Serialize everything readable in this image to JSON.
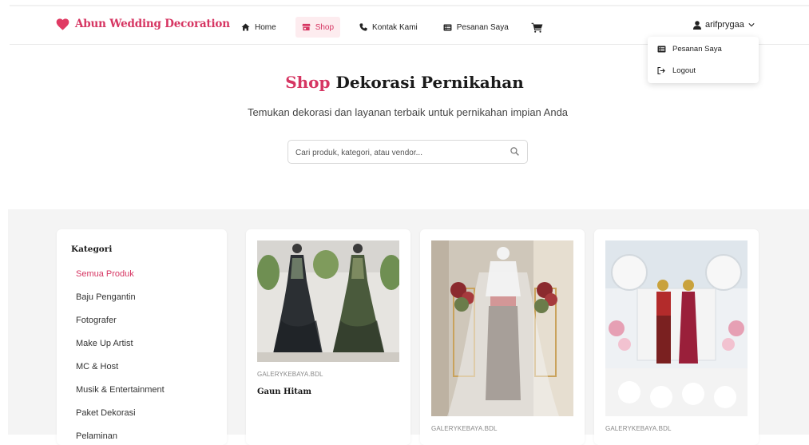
{
  "brand": {
    "name": "Abun Wedding Decoration",
    "color": "#d63562"
  },
  "nav": [
    {
      "label": "Home",
      "icon": "home-icon",
      "active": false
    },
    {
      "label": "Shop",
      "icon": "shop-icon",
      "active": true
    },
    {
      "label": "Kontak Kami",
      "icon": "phone-icon",
      "active": false
    },
    {
      "label": "Pesanan Saya",
      "icon": "list-icon",
      "active": false
    }
  ],
  "cart": {
    "icon": "cart-icon"
  },
  "user": {
    "name": "arifprygaa",
    "icon": "user-icon"
  },
  "dropdown": [
    {
      "label": "Pesanan Saya",
      "icon": "list-icon"
    },
    {
      "label": "Logout",
      "icon": "logout-icon"
    }
  ],
  "hero": {
    "title_accent": "Shop",
    "title_rest": "Dekorasi Pernikahan",
    "subtitle": "Temukan dekorasi dan layanan terbaik untuk pernikahan impian Anda"
  },
  "search": {
    "placeholder": "Cari produk, kategori, atau vendor...",
    "value": ""
  },
  "sidebar": {
    "title": "Kategori",
    "items": [
      {
        "label": "Semua Produk",
        "active": true
      },
      {
        "label": "Baju Pengantin",
        "active": false
      },
      {
        "label": "Fotografer",
        "active": false
      },
      {
        "label": "Make Up Artist",
        "active": false
      },
      {
        "label": "MC & Host",
        "active": false
      },
      {
        "label": "Musik & Entertainment",
        "active": false
      },
      {
        "label": "Paket Dekorasi",
        "active": false
      },
      {
        "label": "Pelaminan",
        "active": false
      }
    ]
  },
  "products": [
    {
      "vendor": "GALERYKEBAYA.BDL",
      "name": "Gaun Hitam"
    },
    {
      "vendor": "GALERYKEBAYA.BDL",
      "name": ""
    },
    {
      "vendor": "GALERYKEBAYA.BDL",
      "name": ""
    }
  ]
}
